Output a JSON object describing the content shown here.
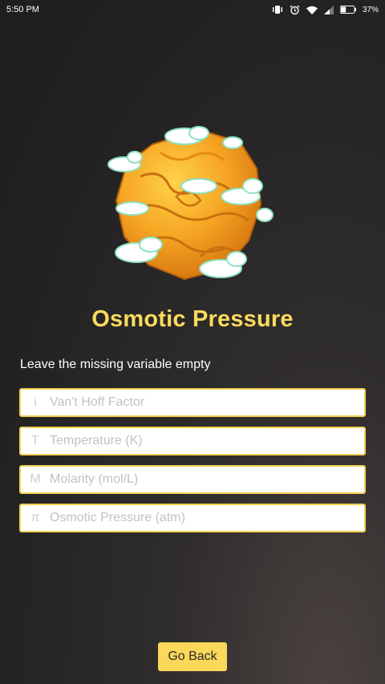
{
  "status_bar": {
    "time": "5:50 PM",
    "battery_percent": "37%",
    "icons": [
      "vibrate-icon",
      "alarm-icon",
      "wifi-icon",
      "signal-icon",
      "battery-icon"
    ]
  },
  "header": {
    "illustration": "planet-illustration",
    "title": "Osmotic Pressure"
  },
  "instruction": "Leave the missing variable empty",
  "fields": [
    {
      "symbol": "i",
      "placeholder": "Van't Hoff Factor",
      "value": ""
    },
    {
      "symbol": "T",
      "placeholder": "Temperature (K)",
      "value": ""
    },
    {
      "symbol": "M",
      "placeholder": "Molarity (mol/L)",
      "value": ""
    },
    {
      "symbol": "π",
      "placeholder": "Osmotic Pressure (atm)",
      "value": ""
    }
  ],
  "actions": {
    "go_back_label": "Go Back"
  },
  "colors": {
    "accent": "#fbdb5c",
    "button": "#fbd75a",
    "field_border": "#f3d155",
    "background": "#2a2828"
  }
}
